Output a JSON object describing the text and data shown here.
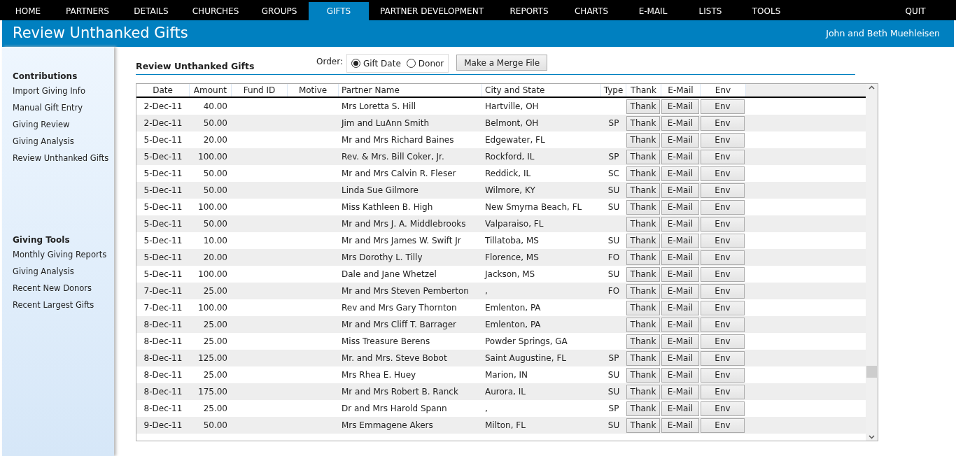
{
  "nav": [
    {
      "label": "HOME",
      "selected": false
    },
    {
      "label": "PARTNERS",
      "selected": false
    },
    {
      "label": "DETAILS",
      "selected": false
    },
    {
      "label": "CHURCHES",
      "selected": false
    },
    {
      "label": "GROUPS",
      "selected": false
    },
    {
      "label": "GIFTS",
      "selected": true
    },
    {
      "label": "PARTNER DEVELOPMENT",
      "selected": false
    },
    {
      "label": "REPORTS",
      "selected": false
    },
    {
      "label": "CHARTS",
      "selected": false
    },
    {
      "label": "E-MAIL",
      "selected": false
    },
    {
      "label": "LISTS",
      "selected": false
    },
    {
      "label": "TOOLS",
      "selected": false
    }
  ],
  "quit": "QUIT",
  "header": {
    "title": "Review Unthanked Gifts",
    "user": "John and Beth Muehleisen"
  },
  "sidebar": [
    {
      "heading": "Contributions",
      "items": [
        "Import Giving Info",
        "Manual Gift Entry",
        "Giving Review",
        "Giving Analysis",
        "Review Unthanked Gifts"
      ]
    },
    {
      "heading": "Giving Tools",
      "items": [
        "Monthly Giving Reports",
        "Giving Analysis",
        "Recent New Donors",
        "Recent Largest Gifts"
      ]
    }
  ],
  "panel_title": "Review Unthanked Gifts",
  "order": {
    "label": "Order:",
    "options": [
      {
        "label": "Gift Date",
        "selected": true
      },
      {
        "label": "Donor",
        "selected": false
      }
    ]
  },
  "merge_button": "Make a Merge File",
  "table": {
    "columns": [
      "Date",
      "Amount",
      "Fund ID",
      "Motive",
      "Partner Name",
      "City and State",
      "Type",
      "Thank",
      "E-Mail",
      "Env"
    ],
    "rows": [
      {
        "date": "2-Dec-11",
        "amount": "40.00",
        "partner": "Mrs Loretta S. Hill",
        "city": "Hartville, OH",
        "type": "",
        "actions": [
          "Thank",
          "E-Mail",
          "Env"
        ]
      },
      {
        "date": "2-Dec-11",
        "amount": "50.00",
        "partner": "Jim and LuAnn Smith",
        "city": "Belmont, OH",
        "type": "SP",
        "actions": [
          "Thank",
          "E-Mail",
          "Env"
        ]
      },
      {
        "date": "5-Dec-11",
        "amount": "20.00",
        "partner": "Mr and Mrs Richard Baines",
        "city": "Edgewater, FL",
        "type": "",
        "actions": [
          "Thank",
          "E-Mail",
          "Env"
        ]
      },
      {
        "date": "5-Dec-11",
        "amount": "100.00",
        "partner": "Rev. & Mrs. Bill Coker, Jr.",
        "city": "Rockford, IL",
        "type": "SP",
        "actions": [
          "Thank",
          "E-Mail",
          "Env"
        ]
      },
      {
        "date": "5-Dec-11",
        "amount": "50.00",
        "partner": "Mr and Mrs Calvin R. Fleser",
        "city": "Reddick, IL",
        "type": "SC",
        "actions": [
          "Thank",
          "E-Mail",
          "Env"
        ]
      },
      {
        "date": "5-Dec-11",
        "amount": "50.00",
        "partner": "Linda Sue Gilmore",
        "city": "Wilmore, KY",
        "type": "SU",
        "actions": [
          "Thank",
          "E-Mail",
          "Env"
        ]
      },
      {
        "date": "5-Dec-11",
        "amount": "100.00",
        "partner": "Miss Kathleen B. High",
        "city": "New Smyrna Beach, FL",
        "type": "SU",
        "actions": [
          "Thank",
          "E-Mail",
          "Env"
        ]
      },
      {
        "date": "5-Dec-11",
        "amount": "50.00",
        "partner": "Mr and Mrs J. A. Middlebrooks",
        "city": "Valparaiso, FL",
        "type": "",
        "actions": [
          "Thank",
          "E-Mail",
          "Env"
        ]
      },
      {
        "date": "5-Dec-11",
        "amount": "10.00",
        "partner": "Mr and Mrs James W. Swift Jr",
        "city": "Tillatoba, MS",
        "type": "SU",
        "actions": [
          "Thank",
          "E-Mail",
          "Env"
        ]
      },
      {
        "date": "5-Dec-11",
        "amount": "20.00",
        "partner": "Mrs Dorothy L. Tilly",
        "city": "Florence, MS",
        "type": "FO",
        "actions": [
          "Thank",
          "E-Mail",
          "Env"
        ]
      },
      {
        "date": "5-Dec-11",
        "amount": "100.00",
        "partner": "Dale and Jane Whetzel",
        "city": "Jackson, MS",
        "type": "SU",
        "actions": [
          "Thank",
          "E-Mail",
          "Env"
        ]
      },
      {
        "date": "7-Dec-11",
        "amount": "25.00",
        "partner": "Mr and Mrs Steven Pemberton",
        "city": ",",
        "type": "FO",
        "actions": [
          "Thank",
          "E-Mail",
          "Env"
        ]
      },
      {
        "date": "7-Dec-11",
        "amount": "100.00",
        "partner": "Rev and Mrs Gary Thornton",
        "city": "Emlenton, PA",
        "type": "",
        "actions": [
          "Thank",
          "E-Mail",
          "Env"
        ]
      },
      {
        "date": "8-Dec-11",
        "amount": "25.00",
        "partner": "Mr and Mrs Cliff T. Barrager",
        "city": "Emlenton, PA",
        "type": "",
        "actions": [
          "Thank",
          "E-Mail",
          "Env"
        ]
      },
      {
        "date": "8-Dec-11",
        "amount": "25.00",
        "partner": "Miss Treasure Berens",
        "city": "Powder Springs, GA",
        "type": "",
        "actions": [
          "Thank",
          "E-Mail",
          "Env"
        ]
      },
      {
        "date": "8-Dec-11",
        "amount": "125.00",
        "partner": "Mr. and Mrs. Steve Bobot",
        "city": "Saint Augustine, FL",
        "type": "SP",
        "actions": [
          "Thank",
          "E-Mail",
          "Env"
        ]
      },
      {
        "date": "8-Dec-11",
        "amount": "25.00",
        "partner": "Mrs Rhea E. Huey",
        "city": "Marion, IN",
        "type": "SU",
        "actions": [
          "Thank",
          "E-Mail",
          "Env"
        ]
      },
      {
        "date": "8-Dec-11",
        "amount": "175.00",
        "partner": "Mr and Mrs Robert B. Ranck",
        "city": "Aurora, IL",
        "type": "SU",
        "actions": [
          "Thank",
          "E-Mail",
          "Env"
        ]
      },
      {
        "date": "8-Dec-11",
        "amount": "25.00",
        "partner": "Dr and Mrs Harold Spann",
        "city": ",",
        "type": "SP",
        "actions": [
          "Thank",
          "E-Mail",
          "Env"
        ]
      },
      {
        "date": "9-Dec-11",
        "amount": "50.00",
        "partner": "Mrs Emmagene Akers",
        "city": "Milton, FL",
        "type": "SU",
        "actions": [
          "Thank",
          "E-Mail",
          "Env"
        ]
      }
    ]
  }
}
